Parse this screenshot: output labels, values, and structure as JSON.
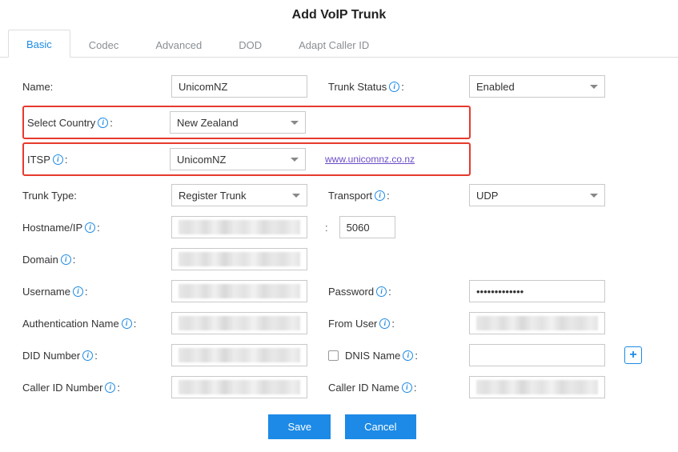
{
  "title": "Add VoIP Trunk",
  "tabs": [
    "Basic",
    "Codec",
    "Advanced",
    "DOD",
    "Adapt Caller ID"
  ],
  "labels": {
    "name": "Name:",
    "trunk_status": "Trunk Status",
    "select_country": "Select Country",
    "itsp": "ITSP",
    "trunk_type": "Trunk Type:",
    "transport": "Transport",
    "hostname": "Hostname/IP",
    "domain": "Domain",
    "username": "Username",
    "password": "Password",
    "auth_name": "Authentication Name",
    "from_user": "From User",
    "did_number": "DID Number",
    "dnis_name": "DNIS Name",
    "caller_id_number": "Caller ID Number",
    "caller_id_name": "Caller ID Name"
  },
  "values": {
    "name": "UnicomNZ",
    "trunk_status": "Enabled",
    "select_country": "New Zealand",
    "itsp": "UnicomNZ",
    "itsp_link": "www.unicomnz.co.nz",
    "trunk_type": "Register Trunk",
    "transport": "UDP",
    "port": "5060",
    "password": "•••••••••••••",
    "dnis_name": ""
  },
  "buttons": {
    "save": "Save",
    "cancel": "Cancel"
  },
  "colon": ":"
}
